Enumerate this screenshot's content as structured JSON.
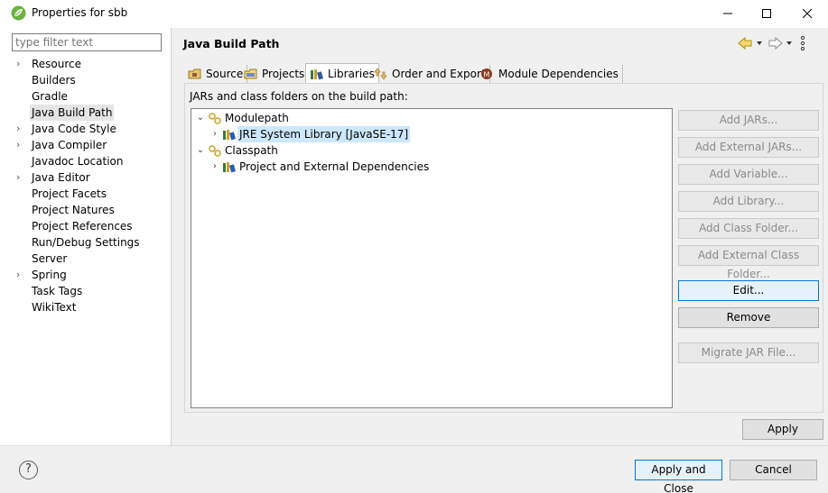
{
  "window": {
    "title": "Properties for sbb"
  },
  "filter": {
    "placeholder": "type filter text"
  },
  "nav": [
    {
      "label": "Resource",
      "expandable": true
    },
    {
      "label": "Builders",
      "expandable": false
    },
    {
      "label": "Gradle",
      "expandable": false
    },
    {
      "label": "Java Build Path",
      "expandable": false,
      "selected": true
    },
    {
      "label": "Java Code Style",
      "expandable": true
    },
    {
      "label": "Java Compiler",
      "expandable": true
    },
    {
      "label": "Javadoc Location",
      "expandable": false
    },
    {
      "label": "Java Editor",
      "expandable": true
    },
    {
      "label": "Project Facets",
      "expandable": false
    },
    {
      "label": "Project Natures",
      "expandable": false
    },
    {
      "label": "Project References",
      "expandable": false
    },
    {
      "label": "Run/Debug Settings",
      "expandable": false
    },
    {
      "label": "Server",
      "expandable": false
    },
    {
      "label": "Spring",
      "expandable": true
    },
    {
      "label": "Task Tags",
      "expandable": false
    },
    {
      "label": "WikiText",
      "expandable": false
    }
  ],
  "page": {
    "title": "Java Build Path"
  },
  "tabs": {
    "source": "Source",
    "projects": "Projects",
    "libraries": "Libraries",
    "order": "Order and Export",
    "modules": "Module Dependencies"
  },
  "libraries": {
    "subtitle": "JARs and class folders on the build path:",
    "tree": {
      "modulepath": "Modulepath",
      "jre": "JRE System Library [JavaSE-17]",
      "classpath": "Classpath",
      "deps": "Project and External Dependencies"
    }
  },
  "buttons": {
    "add_jars": "Add JARs...",
    "add_external_jars": "Add External JARs...",
    "add_variable": "Add Variable...",
    "add_library": "Add Library...",
    "add_class_folder": "Add Class Folder...",
    "add_external_class_folder": "Add External Class Folder...",
    "edit": "Edit...",
    "remove": "Remove",
    "migrate_jar": "Migrate JAR File...",
    "apply": "Apply",
    "apply_close": "Apply and Close",
    "cancel": "Cancel"
  },
  "colors": {
    "selection": "#cce8ff",
    "focus_border": "#0078d7"
  }
}
